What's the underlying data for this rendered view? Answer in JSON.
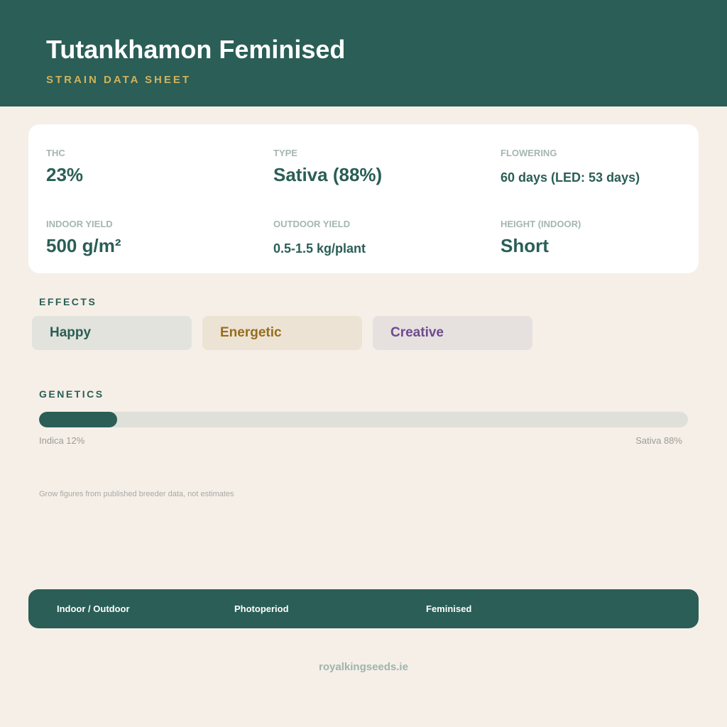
{
  "header": {
    "title": "Tutankhamon Feminised",
    "subtitle": "STRAIN DATA SHEET"
  },
  "stats": [
    {
      "label": "THC",
      "value": "23%"
    },
    {
      "label": "TYPE",
      "value": "Sativa (88%)"
    },
    {
      "label": "FLOWERING",
      "value": "60 days (LED: 53 days)"
    },
    {
      "label": "INDOOR YIELD",
      "value": "500 g/m²"
    },
    {
      "label": "OUTDOOR YIELD",
      "value": "0.5-1.5 kg/plant"
    },
    {
      "label": "HEIGHT (INDOOR)",
      "value": "Short"
    }
  ],
  "effects": {
    "heading": "EFFECTS",
    "items": [
      "Happy",
      "Energetic",
      "Creative"
    ]
  },
  "genetics": {
    "heading": "GENETICS",
    "indica_label": "Indica 12%",
    "sativa_label": "Sativa 88%",
    "indica_fraction": 0.12
  },
  "note": "Grow figures from published breeder data, not estimates",
  "footer": {
    "items": [
      "Indoor / Outdoor",
      "Photoperiod",
      "Feminised"
    ]
  },
  "website": "royalkingseeds.ie",
  "colors": {
    "primary": "#2a5e56",
    "accent": "#d1b25b",
    "background": "#f5efe8"
  }
}
